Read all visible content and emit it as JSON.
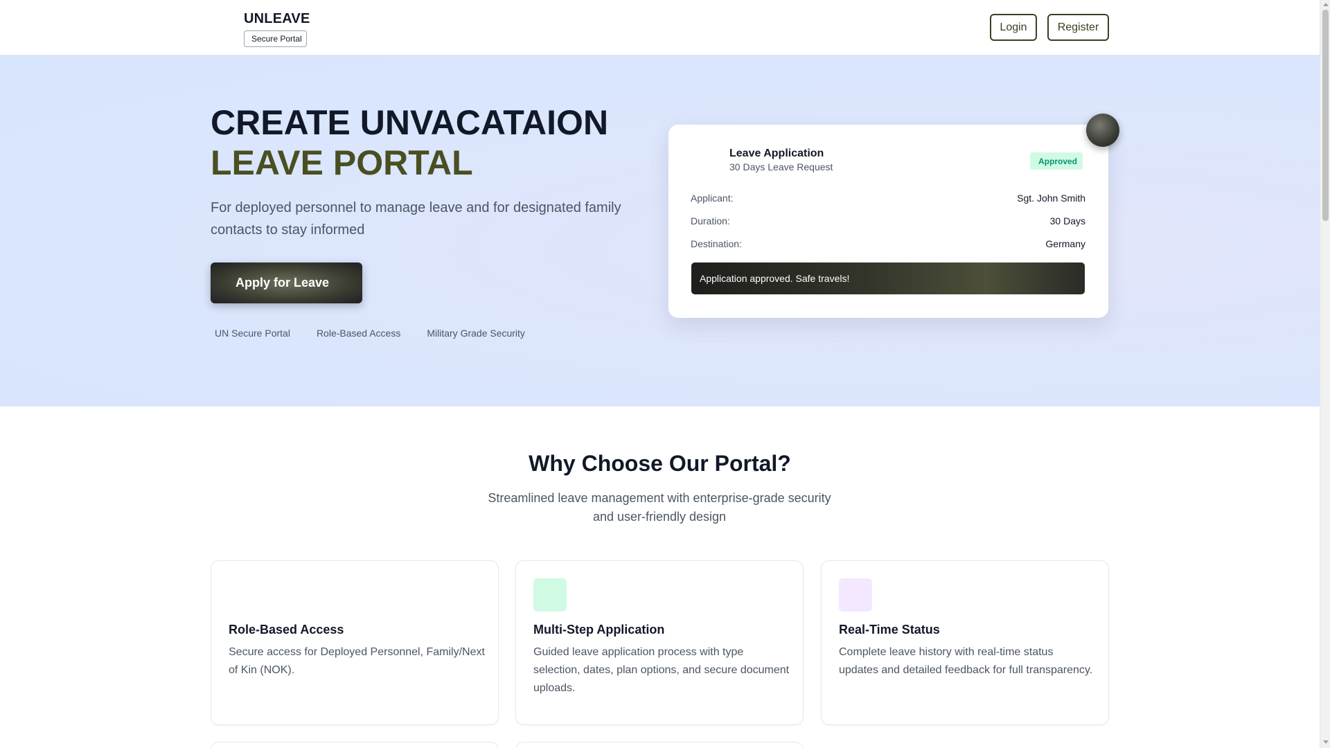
{
  "header": {
    "brand_name": "UNLEAVE",
    "badge_label": "Secure Portal",
    "login_label": "Login",
    "register_label": "Register"
  },
  "hero": {
    "title_line1": "CREATE UNVACATAION",
    "title_line2": "LEAVE PORTAL",
    "subtitle": "For deployed personnel to manage leave and for designated family contacts to stay informed",
    "apply_label": "Apply for Leave",
    "features": [
      "UN Secure Portal",
      "Role-Based Access",
      "Military Grade Security"
    ]
  },
  "leave_card": {
    "title": "Leave Application",
    "subtitle": "30 Days Leave Request",
    "status": "Approved",
    "rows": [
      {
        "label": "Applicant:",
        "value": "Sgt. John Smith"
      },
      {
        "label": "Duration:",
        "value": "30 Days"
      },
      {
        "label": "Destination:",
        "value": "Germany"
      }
    ],
    "notice": "Application approved. Safe travels!"
  },
  "why": {
    "title": "Why Choose Our Portal?",
    "subtitle": "Streamlined leave management with enterprise-grade security and user-friendly design",
    "cards": [
      {
        "title": "Role-Based Access",
        "desc": "Secure access for Deployed Personnel, Family/Next of Kin (NOK)."
      },
      {
        "title": "Multi-Step Application",
        "desc": "Guided leave application process with type selection, dates, plan options, and secure document uploads."
      },
      {
        "title": "Real-Time Status",
        "desc": "Complete leave history with real-time status updates and detailed feedback for full transparency."
      }
    ]
  },
  "colors": {
    "accent_olive": "#4a4f22",
    "approved_green": "#059669",
    "approved_bg": "#d1fae5",
    "hero_bg": "#dbe6fd"
  },
  "icons": {
    "menu": "menu-icon",
    "badge": "shield-icon",
    "apply": "arrow-right-icon",
    "features": [
      "globe-icon",
      "users-icon",
      "shield-icon"
    ],
    "floating": "plane-icon",
    "card_doc": "document-icon",
    "status": "check-circle-icon",
    "why_cards": [
      "users-icon",
      "clipboard-icon",
      "clock-icon"
    ]
  }
}
